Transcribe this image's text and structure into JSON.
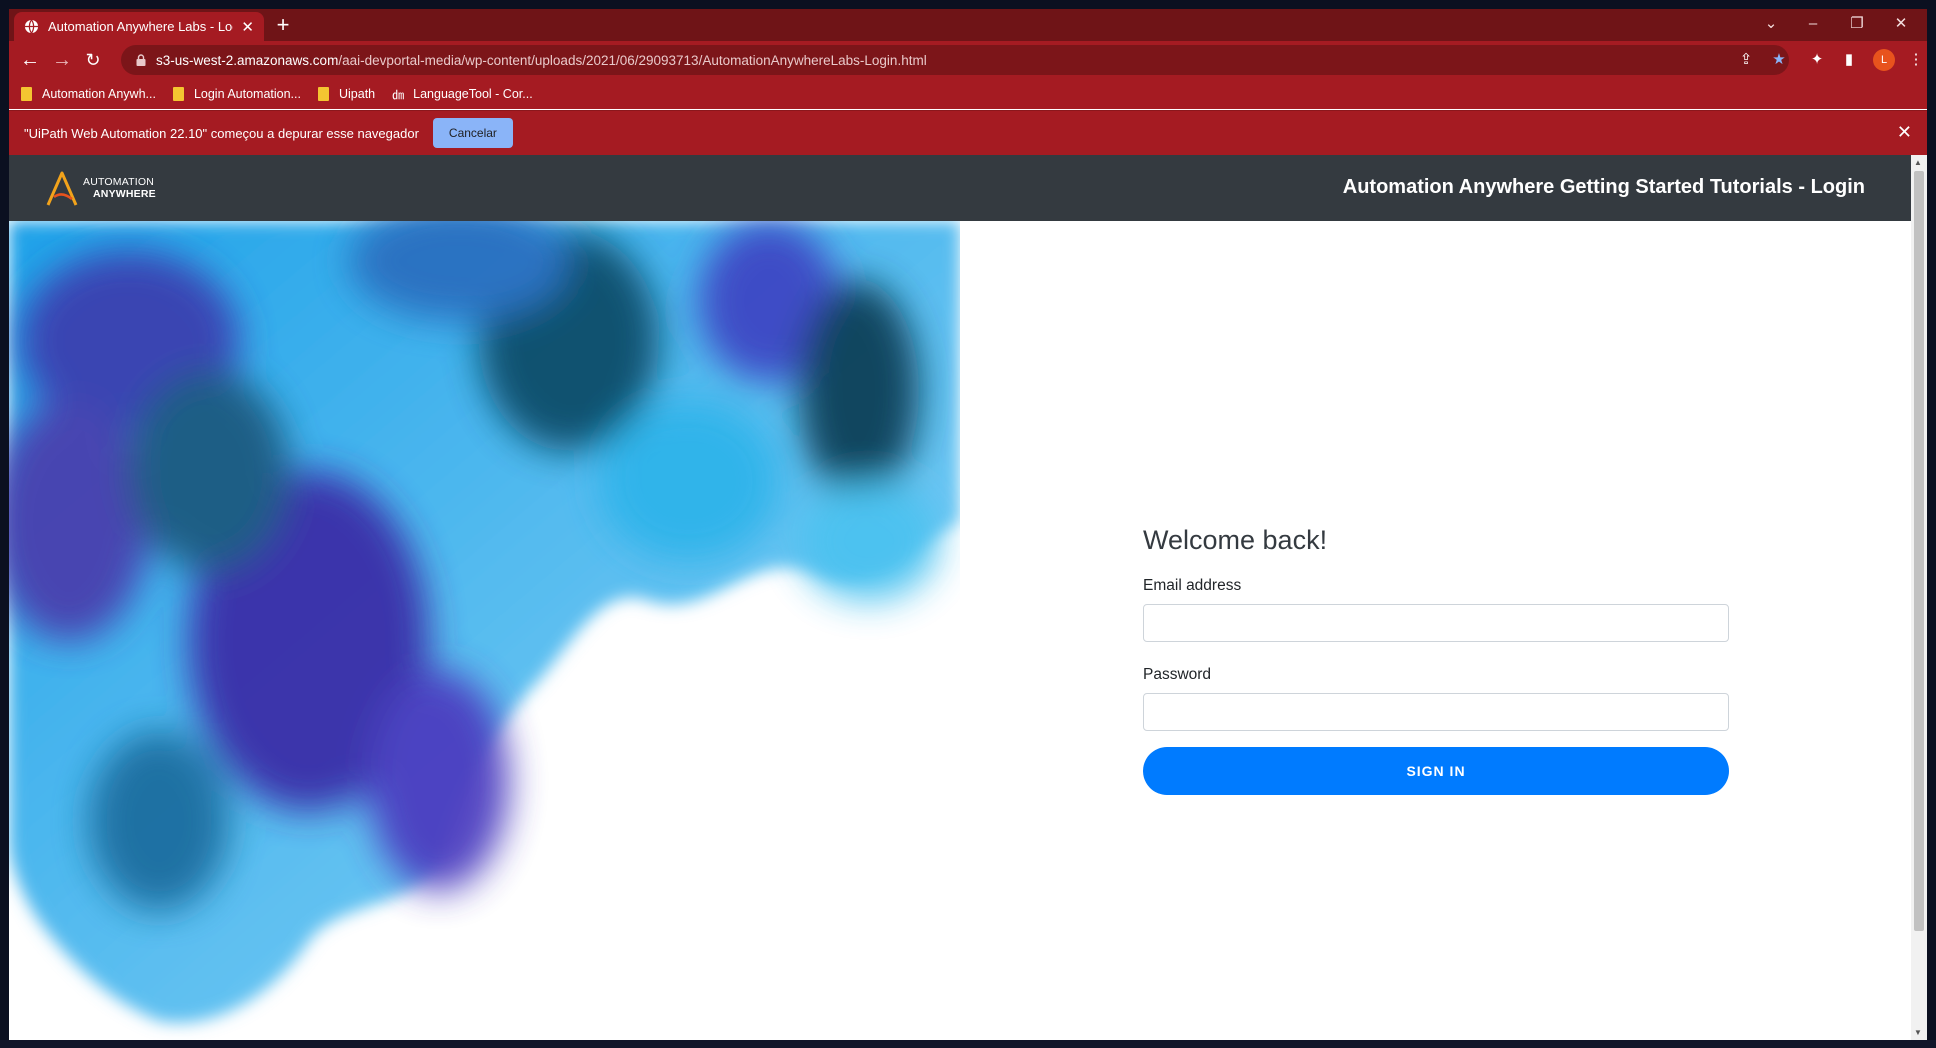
{
  "browser": {
    "tab": {
      "title": "Automation Anywhere Labs - Login"
    },
    "new_tab_label": "+",
    "window_controls": [
      "⌄",
      "–",
      "❐",
      "✕"
    ],
    "address": {
      "host": "s3-us-west-2.amazonaws.com",
      "path": "/aai-devportal-media/wp-content/uploads/2021/06/29093713/AutomationAnywhereLabs-Login.html"
    },
    "avatar_letter": "L",
    "bookmarks": [
      {
        "label": "Automation Anywh...",
        "icon": "folder-icon"
      },
      {
        "label": "Login Automation...",
        "icon": "folder-icon"
      },
      {
        "label": "Uipath",
        "icon": "folder-icon"
      },
      {
        "label": "LanguageTool - Cor...",
        "icon": "languagetool-icon"
      }
    ],
    "infobar": {
      "message": "\"UiPath Web Automation 22.10\" começou a depurar esse navegador",
      "cancel_label": "Cancelar"
    },
    "theme_color": "#a51b22"
  },
  "page": {
    "header": {
      "logo_line1": "AUTOMATION",
      "logo_line2": "ANYWHERE",
      "title": "Automation Anywhere Getting Started Tutorials - Login"
    },
    "form": {
      "heading": "Welcome back!",
      "email_label": "Email address",
      "email_value": "",
      "password_label": "Password",
      "password_value": "",
      "submit_label": "SIGN IN"
    },
    "accent_color": "#007bff"
  }
}
